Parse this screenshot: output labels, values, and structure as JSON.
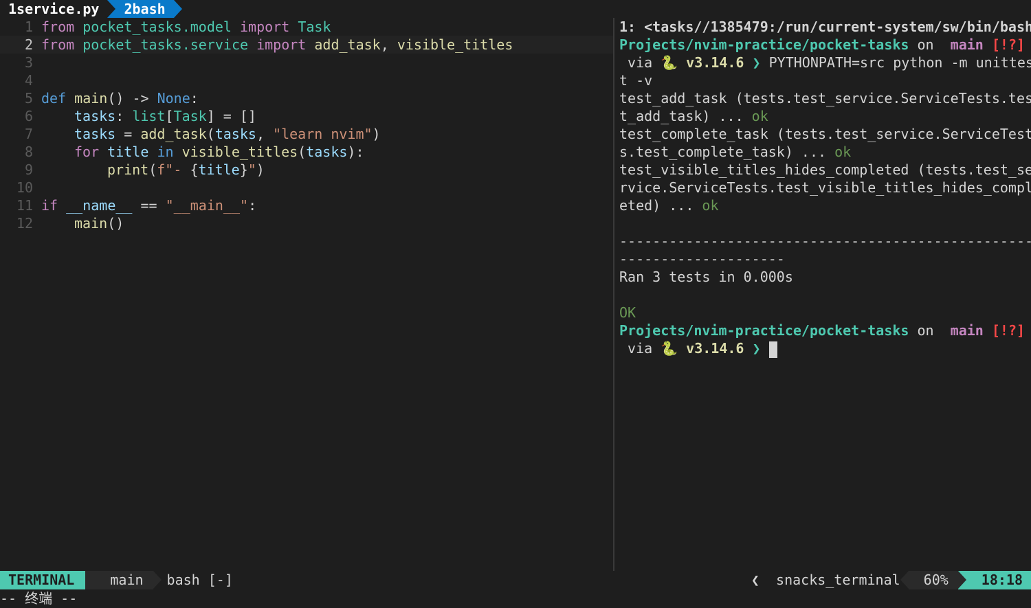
{
  "tabs": [
    {
      "number": "1",
      "label": "service.py"
    },
    {
      "number": "2",
      "label": "bash"
    }
  ],
  "editor": {
    "line_numbers": [
      "1",
      "2",
      "3",
      "4",
      "5",
      "6",
      "7",
      "8",
      "9",
      "10",
      "11",
      "12"
    ],
    "tokens": {
      "from": "from",
      "import": "import",
      "mod1": "pocket_tasks.model",
      "mod2": "pocket_tasks.service",
      "task_cls": "Task",
      "imp2": "add_task",
      "imp2b": "visible_titles",
      "def": "def",
      "main_fn": "main",
      "none": "None",
      "tasks": "tasks",
      "list": "list",
      "add_task": "add_task",
      "learn": "\"learn nvim\"",
      "for": "for",
      "title": "title",
      "in": "in",
      "visible_titles": "visible_titles",
      "print": "print",
      "fstr_a": "f\"- ",
      "fstr_b": "\"",
      "if": "if",
      "name": "__name__",
      "main_str": "\"__main__\""
    }
  },
  "terminal": {
    "header": "1: <tasks//1385479:/run/current-system/sw/bin/bash",
    "prompt_path": "Projects/nvim-practice/pocket-tasks",
    "prompt_on": " on ",
    "branch_icon": "",
    "branch": "main",
    "git_status": "[!?]",
    "via": " via ",
    "python_icon": "🐍",
    "python_version": "v3.14.6",
    "prompt_char": "❯",
    "command_a": "PYTHONPATH=src python -m unittes",
    "command_b": "t -v",
    "r1a": "test_add_task (tests.test_service.ServiceTests.tes",
    "r1b": "t_add_task) ... ",
    "r2a": "test_complete_task (tests.test_service.ServiceTest",
    "r2b": "s.test_complete_task) ... ",
    "r3a": "test_visible_titles_hides_completed (tests.test_se",
    "r3b": "rvice.ServiceTests.test_visible_titles_hides_compl",
    "r3c": "eted) ... ",
    "ok": "ok",
    "sep1": "--------------------------------------------------",
    "sep2": "--------------------",
    "ran": "Ran 3 tests in 0.000s",
    "final_ok": "OK"
  },
  "statusline": {
    "mode": "TERMINAL",
    "branch_icon": "",
    "branch": "main",
    "buffer": "bash [-]",
    "os_icon": "",
    "left_chevron": "❮",
    "ft_icon": "",
    "filetype": "snacks_terminal",
    "percent": "60%",
    "time": "18:18"
  },
  "cmdline": "-- 终端 --",
  "colors": {
    "accent": "#4ec9b0",
    "tab_active": "#0a7aca",
    "error": "#f44747"
  }
}
